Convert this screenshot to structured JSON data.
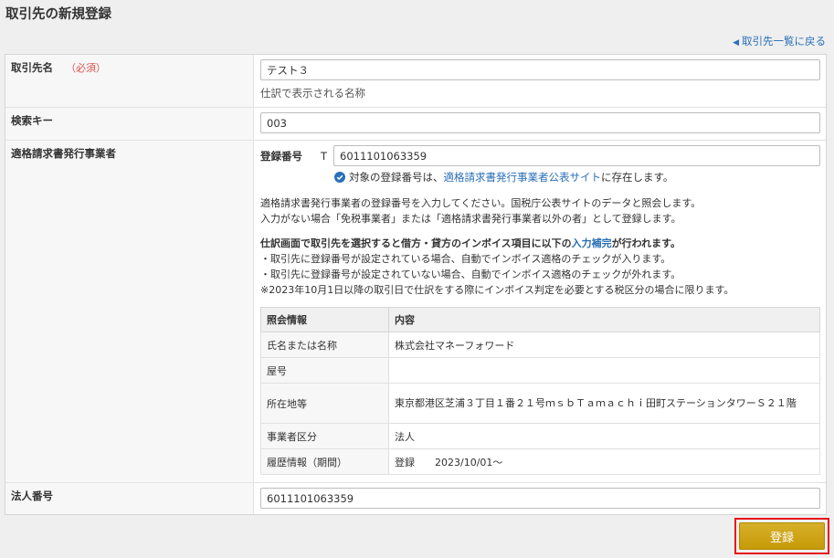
{
  "page": {
    "title": "取引先の新規登録",
    "back_link": "取引先一覧に戻る"
  },
  "fields": {
    "name": {
      "label": "取引先名",
      "required": "（必須）",
      "value": "テスト３",
      "help": "仕訳で表示される名称"
    },
    "search_key": {
      "label": "検索キー",
      "value": "003"
    },
    "invoice": {
      "label": "適格請求書発行事業者",
      "reg_label": "登録番号",
      "prefix": "T",
      "reg_value": "6011101063359",
      "status_pre": "対象の登録番号は、",
      "status_link": "適格請求書発行事業者公表サイト",
      "status_post": "に存在します。",
      "desc1": "適格請求書発行事業者の登録番号を入力してください。国税庁公表サイトのデータと照会します。",
      "desc2": "入力がない場合「免税事業者」または「適格請求書発行事業者以外の者」として登録します。",
      "note_bold_pre": "仕訳画面で取引先を選択すると借方・貸方のインボイス項目に以下の",
      "note_link": "入力補完",
      "note_bold_post": "が行われます。",
      "note1": "・取引先に登録番号が設定されている場合、自動でインボイス適格のチェックが入ります。",
      "note2": "・取引先に登録番号が設定されていない場合、自動でインボイス適格のチェックが外れます。",
      "note3": "※2023年10月1日以降の取引日で仕訳をする際にインボイス判定を必要とする税区分の場合に限ります。",
      "table": {
        "headers": [
          "照会情報",
          "内容"
        ],
        "rows": [
          [
            "氏名または名称",
            "株式会社マネーフォワード"
          ],
          [
            "屋号",
            ""
          ],
          [
            "所在地等",
            "東京都港区芝浦３丁目１番２１号ｍｓｂＴａｍａｃｈｉ田町ステーションタワーＳ２１階"
          ],
          [
            "事業者区分",
            "法人"
          ],
          [
            "履歴情報（期間）",
            "登録　　2023/10/01〜"
          ]
        ]
      }
    },
    "corp_number": {
      "label": "法人番号",
      "value": "6011101063359"
    }
  },
  "submit_label": "登録",
  "colors": {
    "accent": "#c69a07",
    "link": "#2a6fb8",
    "required": "#d9534f",
    "highlight": "#e8141b"
  }
}
